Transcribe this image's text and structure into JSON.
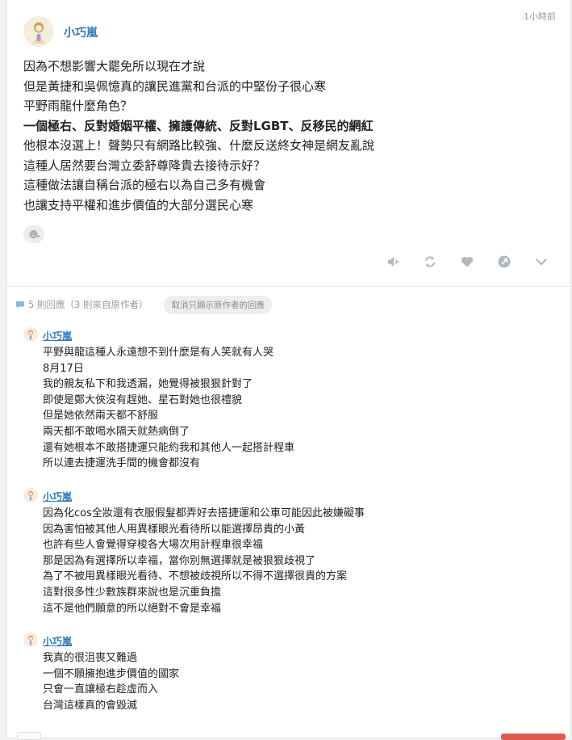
{
  "post": {
    "author": "小巧嵐",
    "timestamp": "1小時前",
    "lines": [
      {
        "text": "因為不想影響大罷免所以現在才說",
        "bold": false
      },
      {
        "text": "但是黃捷和吳佩憶真的讓民進黨和台派的中堅份子很心寒",
        "bold": false
      },
      {
        "text": "平野雨龍什麼角色？",
        "bold": false
      },
      {
        "text": "一個極右、反對婚姻平權、擁護傳統、反對LGBT、反移民的網紅",
        "bold": true
      },
      {
        "text": "他根本沒選上！聲勢只有網路比較強、什麼反送終女神是網友亂說",
        "bold": false
      },
      {
        "text": "這種人居然要台灣立委舒尊降貴去接待示好？",
        "bold": false
      },
      {
        "text": "這種做法讓自稱台派的極右以為自己多有機會",
        "bold": false
      },
      {
        "text": "也讓支持平權和進步價值的大部分選民心寒",
        "bold": false
      }
    ],
    "actions": [
      "speaker-icon",
      "repost-icon",
      "heart-icon",
      "share-icon",
      "chevron-down-icon"
    ]
  },
  "replies_bar": {
    "count_text": "5 則回應（3 則來自原作者）",
    "filter_chip": "取消只顯示原作者的回應"
  },
  "replies": [
    {
      "author": "小巧嵐",
      "lines": [
        "平野與龍這種人永遠想不到什麼是有人笑就有人哭",
        "8月17日",
        "我的親友私下和我透漏，她覺得被狠狠針對了",
        "即使是鄭大俠沒有趕她、星石對她也很禮貌",
        "但是她依然兩天都不舒服",
        "兩天都不敢喝水隔天就熱病倒了",
        "還有她根本不敢搭捷運只能約我和其他人一起搭計程車",
        "所以連去捷運洗手間的機會都沒有"
      ]
    },
    {
      "author": "小巧嵐",
      "lines": [
        "因為化cos全妝還有衣服假髮都弄好去搭捷運和公車可能因此被嫌礙事",
        "因為害怕被其他人用異樣眼光看待所以能選擇昂貴的小黃",
        "也許有些人會覺得穿梭各大場次用計程車很幸福",
        "那是因為有選擇所以幸福，當你別無選擇就是被狠狠歧視了",
        "為了不被用異樣眼光看待、不想被歧視所以不得不選擇很貴的方案",
        "這對很多性少數族群來說也是沉重負擔",
        "這不是他們願意的所以絕對不會是幸福"
      ]
    },
    {
      "author": "小巧嵐",
      "lines": [
        "我真的很沮喪又難過",
        "一個不願擁抱進步價值的國家",
        "只會一直讓極右趁虛而入",
        "台灣這樣真的會毀滅"
      ]
    }
  ],
  "colors": {
    "author_link": "#2e7ab8",
    "muted": "#9a9a9a",
    "icon": "#b3b8c0",
    "background": "#f0f1f2",
    "accent_red": "#e05a4e"
  }
}
